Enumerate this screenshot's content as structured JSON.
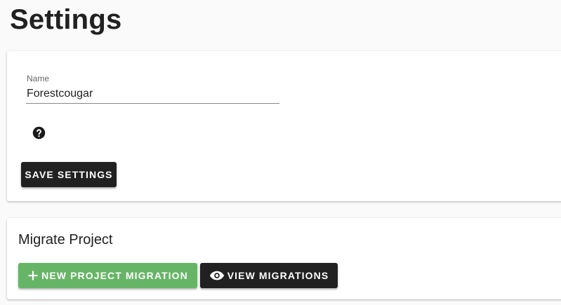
{
  "page": {
    "title": "Settings"
  },
  "settings_card": {
    "name_label": "Name",
    "name_value": "Forestcougar",
    "help_icon": "help-circle-icon",
    "save_button": "SAVE SETTINGS"
  },
  "migrate_card": {
    "title": "Migrate Project",
    "new_migration_button": "NEW PROJECT MIGRATION",
    "new_migration_icon": "plus-icon",
    "view_migrations_button": "VIEW MIGRATIONS",
    "view_migrations_icon": "eye-icon"
  },
  "colors": {
    "primary_dark": "#212121",
    "success_green": "#66b566",
    "background": "#fafafa"
  }
}
